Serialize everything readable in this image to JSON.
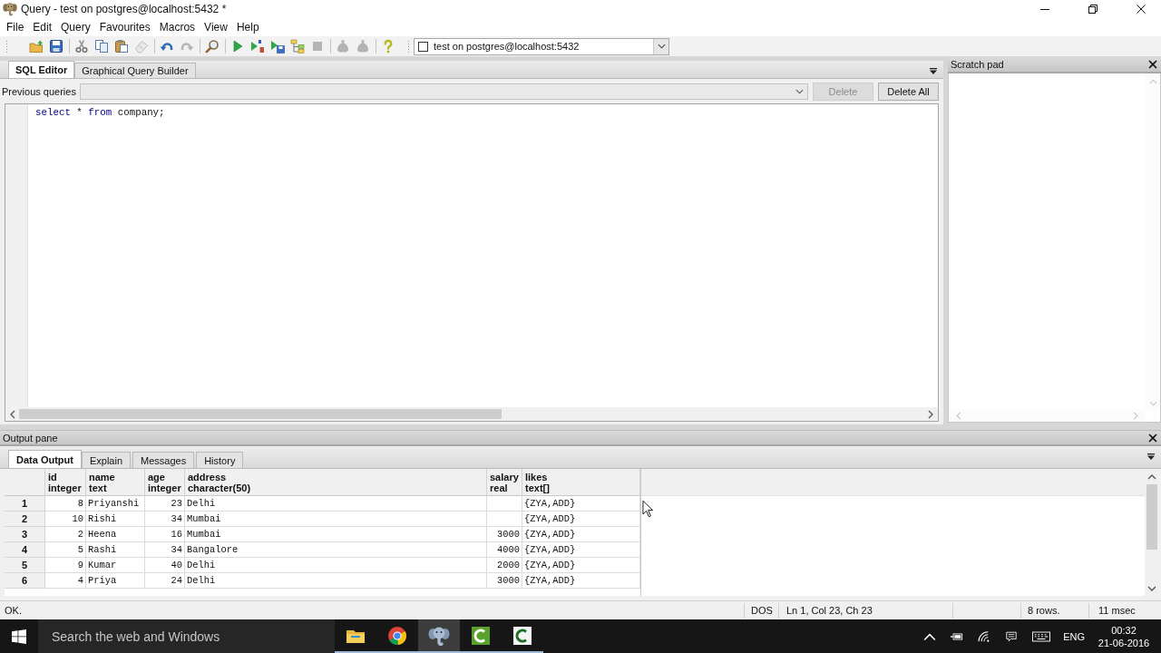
{
  "window": {
    "title": "Query - test on postgres@localhost:5432 *"
  },
  "menu": [
    "File",
    "Edit",
    "Query",
    "Favourites",
    "Macros",
    "View",
    "Help"
  ],
  "toolbar_groups": [
    [
      {
        "kind": "open",
        "disabled": false
      },
      {
        "kind": "save",
        "disabled": false
      }
    ],
    [
      {
        "kind": "cut",
        "disabled": false
      },
      {
        "kind": "copy",
        "disabled": false
      },
      {
        "kind": "paste",
        "disabled": false
      },
      {
        "kind": "clear",
        "disabled": true
      }
    ],
    [
      {
        "kind": "undo",
        "disabled": false
      },
      {
        "kind": "redo",
        "disabled": true
      }
    ],
    [
      {
        "kind": "find",
        "disabled": false
      }
    ],
    [
      {
        "kind": "execute",
        "disabled": false
      },
      {
        "kind": "script",
        "disabled": false
      },
      {
        "kind": "export",
        "disabled": false
      },
      {
        "kind": "explain",
        "disabled": false
      },
      {
        "kind": "cancel",
        "disabled": true
      }
    ],
    [
      {
        "kind": "sack",
        "disabled": true
      },
      {
        "kind": "sack",
        "disabled": true
      }
    ],
    [
      {
        "kind": "help",
        "disabled": false
      }
    ]
  ],
  "connection": {
    "value": "test on postgres@localhost:5432"
  },
  "editor": {
    "tabs": [
      {
        "label": "SQL Editor",
        "selected": true
      },
      {
        "label": "Graphical Query Builder",
        "selected": false
      }
    ],
    "previous_queries": {
      "label": "Previous queries",
      "buttons": [
        {
          "label": "Delete",
          "disabled": true
        },
        {
          "label": "Delete All",
          "disabled": false
        }
      ]
    },
    "lines": [
      [
        {
          "text": "select",
          "kind": "keyword"
        },
        {
          "text": " * ",
          "kind": "plain"
        },
        {
          "text": "from",
          "kind": "keyword"
        },
        {
          "text": " company;",
          "kind": "plain"
        }
      ]
    ]
  },
  "scratch_pad": {
    "title": "Scratch pad"
  },
  "output_pane": {
    "title": "Output pane",
    "tabs": [
      {
        "label": "Data Output",
        "selected": true
      },
      {
        "label": "Explain",
        "selected": false
      },
      {
        "label": "Messages",
        "selected": false
      },
      {
        "label": "History",
        "selected": false
      }
    ],
    "table": {
      "columns": [
        {
          "name": "id",
          "type": "integer",
          "kind": "number"
        },
        {
          "name": "name",
          "type": "text",
          "kind": "text"
        },
        {
          "name": "age",
          "type": "integer",
          "kind": "number"
        },
        {
          "name": "address",
          "type": "character(50)",
          "kind": "text"
        },
        {
          "name": "salary",
          "type": "real",
          "kind": "number"
        },
        {
          "name": "likes",
          "type": "text[]",
          "kind": "text"
        }
      ],
      "rows": [
        {
          "number": "1",
          "cells": [
            "8",
            "Priyanshi",
            "23",
            "Delhi",
            null,
            "{ZYA,ADD}"
          ]
        },
        {
          "number": "2",
          "cells": [
            "10",
            "Rishi",
            "34",
            "Mumbai",
            null,
            "{ZYA,ADD}"
          ]
        },
        {
          "number": "3",
          "cells": [
            "2",
            "Heena",
            "16",
            "Mumbai",
            "3000",
            "{ZYA,ADD}"
          ]
        },
        {
          "number": "4",
          "cells": [
            "5",
            "Rashi",
            "34",
            "Bangalore",
            "4000",
            "{ZYA,ADD}"
          ]
        },
        {
          "number": "5",
          "cells": [
            "9",
            "Kumar",
            "40",
            "Delhi",
            "2000",
            "{ZYA,ADD}"
          ]
        },
        {
          "number": "6",
          "cells": [
            "4",
            "Priya",
            "24",
            "Delhi",
            "3000",
            "{ZYA,ADD}"
          ]
        }
      ]
    }
  },
  "status_bar": {
    "message": "OK.",
    "line_endings": "DOS",
    "position": "Ln 1, Col 23, Ch 23",
    "row_count": "8 rows.",
    "duration": "11 msec"
  },
  "taskbar": {
    "search": {
      "placeholder": "Search the web and Windows"
    },
    "apps": [
      {
        "kind": "folder",
        "running": true,
        "active": false
      },
      {
        "kind": "browser",
        "running": true,
        "active": false
      },
      {
        "kind": "elephant",
        "running": true,
        "active": true
      },
      {
        "kind": "cgreen",
        "running": true,
        "active": false
      },
      {
        "kind": "cwhite",
        "running": true,
        "active": false
      }
    ],
    "tray": {
      "language": "ENG",
      "time": "00:32",
      "date": "21-06-2016"
    }
  }
}
